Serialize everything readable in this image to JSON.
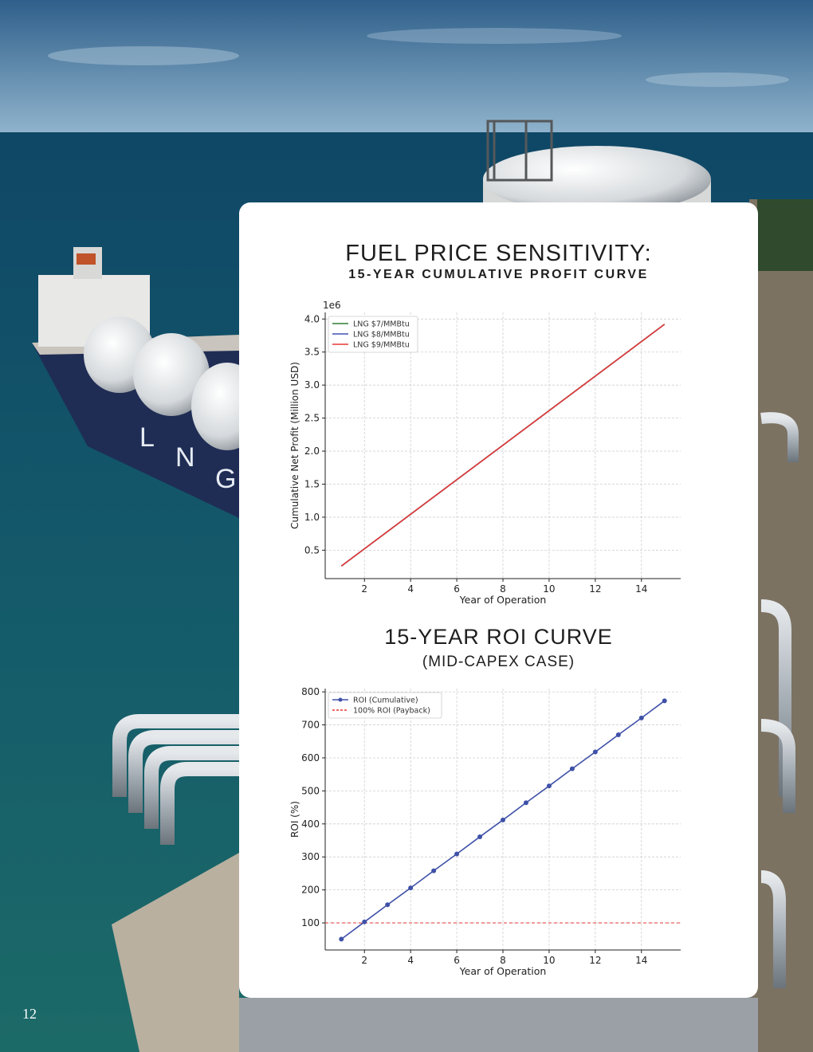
{
  "page_number": "12",
  "chart_data": [
    {
      "type": "line",
      "title": "FUEL PRICE SENSITIVITY:",
      "subtitle": "15-YEAR CUMULATIVE PROFIT CURVE",
      "xlabel": "Year of Operation",
      "ylabel": "Cumulative Net Profit (Million USD)",
      "y_offset_label": "1e6",
      "xlim": [
        0.3,
        15.7
      ],
      "ylim": [
        0.07,
        4.1
      ],
      "xticks": [
        2,
        4,
        6,
        8,
        10,
        12,
        14
      ],
      "yticks": [
        0.5,
        1.0,
        1.5,
        2.0,
        2.5,
        3.0,
        3.5,
        4.0
      ],
      "ytick_labels": [
        "0.5",
        "1.0",
        "1.5",
        "2.0",
        "2.5",
        "3.0",
        "3.5",
        "4.0"
      ],
      "grid": true,
      "legend_position": "top-left",
      "x": [
        1,
        15
      ],
      "series": [
        {
          "name": "LNG $7/MMBtu",
          "color": "#2e7d32",
          "values": [
            0.26,
            3.92
          ]
        },
        {
          "name": "LNG $8/MMBtu",
          "color": "#3f51b5",
          "values": [
            0.26,
            3.92
          ]
        },
        {
          "name": "LNG $9/MMBtu",
          "color": "#e53935",
          "values": [
            0.26,
            3.92
          ]
        }
      ]
    },
    {
      "type": "line",
      "title": "15-YEAR ROI CURVE",
      "subtitle": "(MID-CAPEX CASE)",
      "xlabel": "Year of Operation",
      "ylabel": "ROI (%)",
      "xlim": [
        0.3,
        15.7
      ],
      "ylim": [
        18,
        810
      ],
      "xticks": [
        2,
        4,
        6,
        8,
        10,
        12,
        14
      ],
      "yticks": [
        100,
        200,
        300,
        400,
        500,
        600,
        700,
        800
      ],
      "ytick_labels": [
        "100",
        "200",
        "300",
        "400",
        "500",
        "600",
        "700",
        "800"
      ],
      "grid": true,
      "legend_position": "top-left",
      "x": [
        1,
        2,
        3,
        4,
        5,
        6,
        7,
        8,
        9,
        10,
        11,
        12,
        13,
        14,
        15
      ],
      "series": [
        {
          "name": "ROI (Cumulative)",
          "color": "#3f51a8",
          "markers": true,
          "values": [
            51,
            103,
            155,
            206,
            258,
            309,
            361,
            412,
            464,
            515,
            567,
            618,
            670,
            721,
            773
          ]
        }
      ],
      "reference_line": {
        "name": "100% ROI (Payback)",
        "value": 100,
        "color": "#e53935",
        "style": "dashed"
      }
    }
  ]
}
